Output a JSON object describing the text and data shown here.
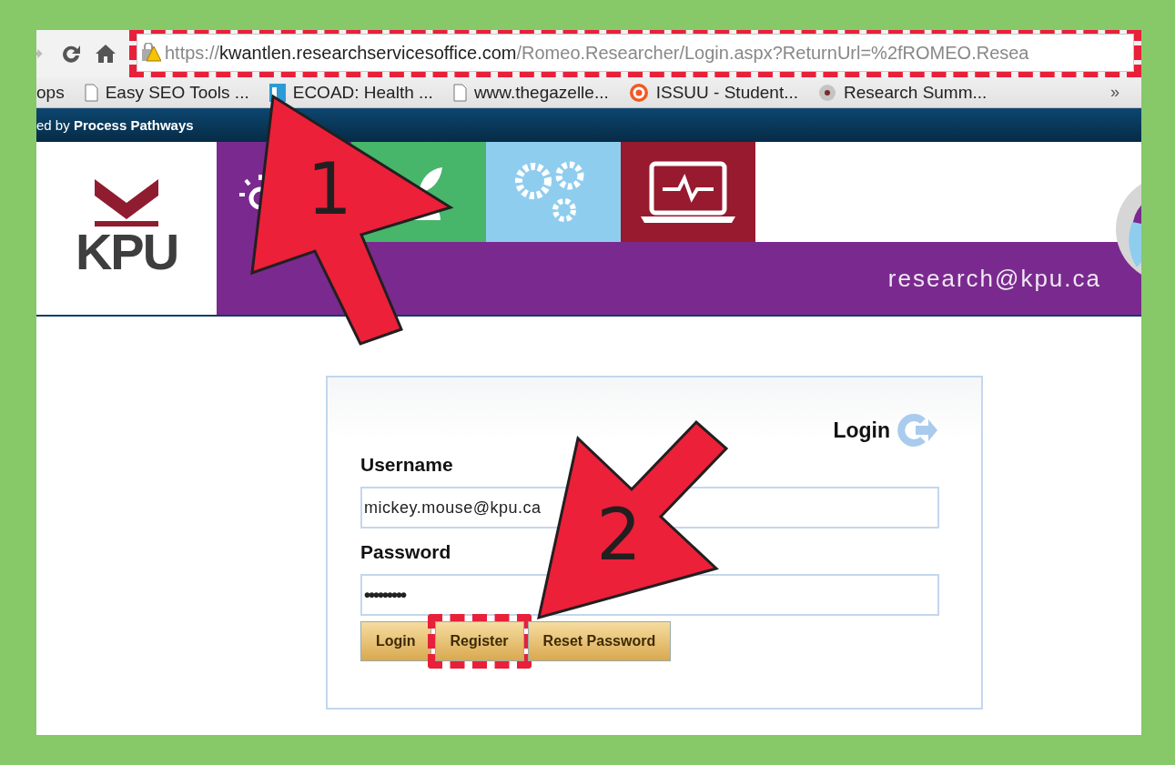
{
  "browser": {
    "address_bar": {
      "scheme": "https://",
      "host": "kwantlen.researchservicesoffice.com",
      "path": "/Romeo.Researcher/Login.aspx?ReturnUrl=%2fROMEO.Resea",
      "highlighted": true
    },
    "bookmarks": [
      {
        "kind": "plain",
        "label": "ops"
      },
      {
        "kind": "page",
        "label": "Easy SEO Tools ..."
      },
      {
        "kind": "tile",
        "label": "ECOAD: Health ..."
      },
      {
        "kind": "page",
        "label": "www.thegazelle..."
      },
      {
        "kind": "target",
        "label": "ISSUU - Student..."
      },
      {
        "kind": "dot",
        "label": "Research Summ..."
      }
    ],
    "more": "»"
  },
  "banner": {
    "text": "ed by **Process Pathways**"
  },
  "header": {
    "logo": "KPU",
    "email": "research@kpu.ca"
  },
  "login": {
    "title": "Login",
    "username_label": "Username",
    "username_value": "mickey.mouse@kpu.ca",
    "password_label": "Password",
    "password_value": "•••••••••",
    "buttons": [
      {
        "label": "Login",
        "highlighted": false
      },
      {
        "label": "Register",
        "highlighted": true
      },
      {
        "label": "Reset Password",
        "highlighted": false
      }
    ]
  },
  "callouts": [
    {
      "label": "1"
    },
    {
      "label": "2"
    }
  ]
}
